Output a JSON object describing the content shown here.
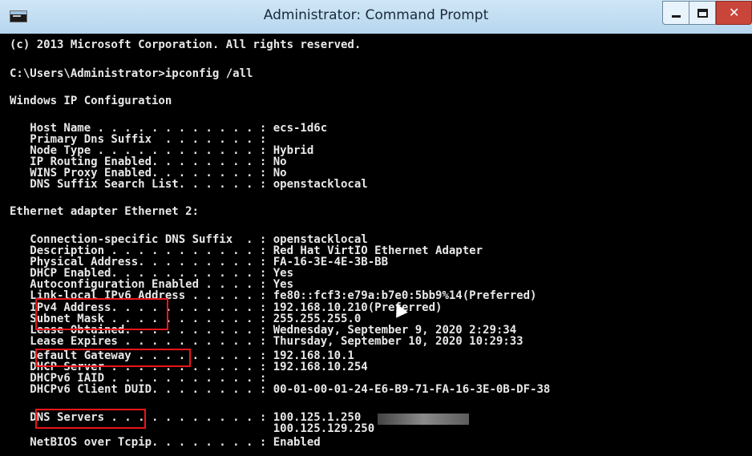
{
  "window": {
    "title": "Administrator: Command Prompt",
    "buttons": {
      "minimize": "minimize-icon",
      "maximize": "maximize-icon",
      "close": "close-icon"
    },
    "close_color": "#c9453a"
  },
  "console": {
    "lines": [
      "(c) 2013 Microsoft Corporation. All rights reserved.",
      "C:\\Users\\Administrator>ipconfig /all",
      "Windows IP Configuration",
      "   Host Name . . . . . . . . . . . . : ecs-1d6c",
      "   Primary Dns Suffix  . . . . . . . :",
      "   Node Type . . . . . . . . . . . . : Hybrid",
      "   IP Routing Enabled. . . . . . . . : No",
      "   WINS Proxy Enabled. . . . . . . . : No",
      "   DNS Suffix Search List. . . . . . : openstacklocal",
      "Ethernet adapter Ethernet 2:",
      "   Connection-specific DNS Suffix  . : openstacklocal",
      "   Description . . . . . . . . . . . : Red Hat VirtIO Ethernet Adapter",
      "   Physical Address. . . . . . . . . : FA-16-3E-4E-3B-BB",
      "   DHCP Enabled. . . . . . . . . . . : Yes",
      "   Autoconfiguration Enabled . . . . : Yes",
      "   Link-local IPv6 Address . . . . . : fe80::fcf3:e79a:b7e0:5bb9%14(Preferred)",
      "   IPv4 Address. . . . . . . . . . . : 192.168.10.210(Preferred)",
      "   Subnet Mask . . . . . . . . . . . : 255.255.255.0",
      "   Lease Obtained. . . . . . . . . . : Wednesday, September 9, 2020 2:29:34",
      "   Lease Expires . . . . . . . . . . : Thursday, September 10, 2020 10:29:33",
      "   Default Gateway . . . . . . . . . : 192.168.10.1",
      "   DHCP Server . . . . . . . . . . . : 192.168.10.254",
      "   DHCPv6 IAID . . . . . . . . . . . :",
      "   DHCPv6 Client DUID. . . . . . . . : 00-01-00-01-24-E6-B9-71-FA-16-3E-0B-DF-38",
      "   DNS Servers . . . . . . . . . . . : 100.125.1.250",
      "                                       100.125.129.250",
      "   NetBIOS over Tcpip. . . . . . . . : Enabled"
    ],
    "text_color": "#e8e8e8",
    "background": "#000000"
  },
  "annotations": {
    "highlight_color": "#e8161b",
    "highlighted_fields": [
      "IPv4 Address",
      "Subnet Mask",
      "Default Gateway",
      "DNS Servers"
    ]
  }
}
